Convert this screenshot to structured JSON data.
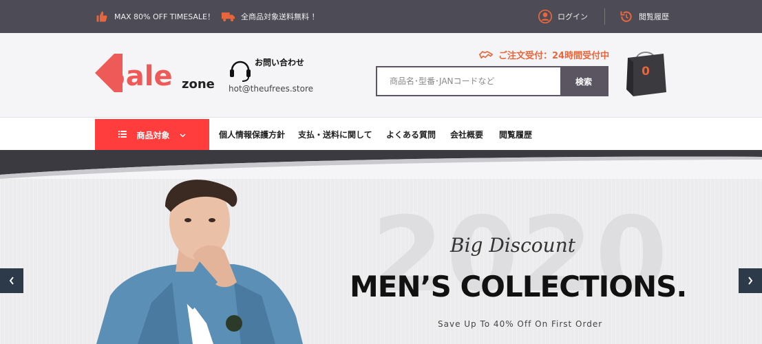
{
  "topbar": {
    "sale_text": "MAX 80% OFF TIMESALE！",
    "shipping_text": "全商品対象送料無料 ！",
    "login_label": "ログイン",
    "history_label": "閲覧履歴"
  },
  "header": {
    "logo_text": "Sale",
    "logo_sub": "zone",
    "contact_title": "お問い合わせ",
    "contact_email": "hot@theufrees.store",
    "order_note": "ご注文受付：24時間受付中",
    "search_placeholder": "商品名･型番･JANコードなど",
    "search_button": "検索",
    "cart_count": "0"
  },
  "nav": {
    "category_label": "商品対象",
    "links": [
      "個人情報保護方針",
      "支払・送料に関して",
      "よくある質問",
      "会社概要",
      "閲覧履歴"
    ]
  },
  "hero": {
    "year": "2020",
    "tagline": "Big Discount",
    "headline": "MEN’S COLLECTIONS.",
    "subtext": "Save Up To 40% Off On First Order"
  },
  "colors": {
    "topbar_bg": "#4d4b55",
    "accent_orange": "#e8663c",
    "accent_red": "#ff3d3d",
    "search_button_bg": "#5a5560",
    "slider_arrow_bg": "#2d3a4a"
  }
}
